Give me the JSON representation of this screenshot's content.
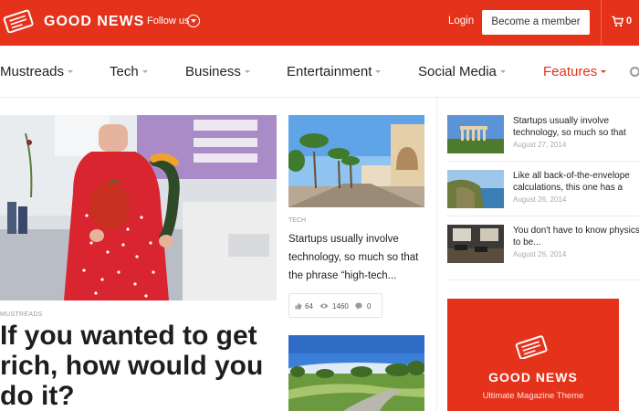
{
  "header": {
    "logo_text": "GOOD NEWS",
    "follow_label": "Follow us",
    "login_label": "Login",
    "member_button": "Become a member",
    "cart_count": "0",
    "brand_color": "#e4321b"
  },
  "nav": {
    "items": [
      {
        "label": "Mustreads"
      },
      {
        "label": "Tech"
      },
      {
        "label": "Business"
      },
      {
        "label": "Entertainment"
      },
      {
        "label": "Social Media"
      },
      {
        "label": "Features"
      }
    ],
    "active_item": "Features"
  },
  "hero": {
    "image": "kitchen-woman-vegetables",
    "category": "MUSTREADS",
    "title": "If you wanted to get rich, how would you do it?"
  },
  "middle": {
    "image1": "palm-tree-boulevard",
    "category": "TECH",
    "excerpt": "Startups usually involve technology, so much so that the phrase “high-tech...",
    "likes": "64",
    "views": "1460",
    "comments": "0",
    "image2": "countryside-road"
  },
  "sidebar": {
    "items": [
      {
        "image": "ruins-columns",
        "title": "Startups usually involve technology, so much so that",
        "date": "August 27, 2014"
      },
      {
        "image": "coastal-cliffs",
        "title": "Like all back-of-the-envelope calculations, this one has a",
        "date": "August 26, 2014"
      },
      {
        "image": "restaurant-interior",
        "title": "You don't have to know physics to be...",
        "date": "August 26, 2014"
      }
    ]
  },
  "ad": {
    "title": "GOOD NEWS",
    "subtitle": "Ultimate Magazine Theme"
  }
}
